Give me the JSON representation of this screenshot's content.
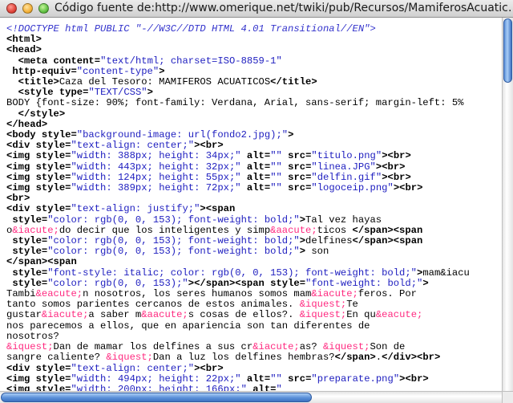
{
  "window": {
    "title": "Código fuente de:http://www.omerique.net/twiki/pub/Recursos/MamiferosAcuatic…"
  },
  "source_lines": [
    [
      {
        "t": "<!DOCTYPE html PUBLIC \"-//W3C//DTD HTML 4.01 Transitional//EN\">",
        "c": "doctype"
      }
    ],
    [
      {
        "t": "<html>",
        "c": "tag"
      }
    ],
    [
      {
        "t": "<head>",
        "c": "tag"
      }
    ],
    [
      {
        "t": "  "
      },
      {
        "t": "<meta",
        "c": "tag"
      },
      {
        "t": " content",
        "c": "attr"
      },
      {
        "t": "=",
        "c": "attr"
      },
      {
        "t": "\"text/html; charset=ISO-8859-1\"",
        "c": "val"
      }
    ],
    [
      {
        "t": " http-equiv",
        "c": "attr"
      },
      {
        "t": "=",
        "c": "attr"
      },
      {
        "t": "\"content-type\"",
        "c": "val"
      },
      {
        "t": ">",
        "c": "tag"
      }
    ],
    [
      {
        "t": "  "
      },
      {
        "t": "<title>",
        "c": "tag"
      },
      {
        "t": "Caza del Tesoro: MAMIFEROS ACUATICOS"
      },
      {
        "t": "</title>",
        "c": "tag"
      }
    ],
    [
      {
        "t": "  "
      },
      {
        "t": "<style",
        "c": "tag"
      },
      {
        "t": " type",
        "c": "attr"
      },
      {
        "t": "=",
        "c": "attr"
      },
      {
        "t": "\"TEXT/CSS\"",
        "c": "val"
      },
      {
        "t": ">",
        "c": "tag"
      }
    ],
    [
      {
        "t": "BODY {font-size: 90%; font-family: Verdana, Arial, sans-serif; margin-left: 5%"
      }
    ],
    [
      {
        "t": "  "
      },
      {
        "t": "</style>",
        "c": "tag"
      }
    ],
    [
      {
        "t": "</head>",
        "c": "tag"
      }
    ],
    [
      {
        "t": "<body",
        "c": "tag"
      },
      {
        "t": " style",
        "c": "attr"
      },
      {
        "t": "=",
        "c": "attr"
      },
      {
        "t": "\"background-image: url(fondo2.jpg);\"",
        "c": "val"
      },
      {
        "t": ">",
        "c": "tag"
      }
    ],
    [
      {
        "t": "<div",
        "c": "tag"
      },
      {
        "t": " style",
        "c": "attr"
      },
      {
        "t": "=",
        "c": "attr"
      },
      {
        "t": "\"text-align: center;\"",
        "c": "val"
      },
      {
        "t": "><br>",
        "c": "tag"
      }
    ],
    [
      {
        "t": "<img",
        "c": "tag"
      },
      {
        "t": " style",
        "c": "attr"
      },
      {
        "t": "=",
        "c": "attr"
      },
      {
        "t": "\"width: 388px; height: 34px;\"",
        "c": "val"
      },
      {
        "t": " alt",
        "c": "attr"
      },
      {
        "t": "=",
        "c": "attr"
      },
      {
        "t": "\"\"",
        "c": "val"
      },
      {
        "t": " src",
        "c": "attr"
      },
      {
        "t": "=",
        "c": "attr"
      },
      {
        "t": "\"titulo.png\"",
        "c": "val"
      },
      {
        "t": "><br>",
        "c": "tag"
      }
    ],
    [
      {
        "t": "<img",
        "c": "tag"
      },
      {
        "t": " style",
        "c": "attr"
      },
      {
        "t": "=",
        "c": "attr"
      },
      {
        "t": "\"width: 443px; height: 32px;\"",
        "c": "val"
      },
      {
        "t": " alt",
        "c": "attr"
      },
      {
        "t": "=",
        "c": "attr"
      },
      {
        "t": "\"\"",
        "c": "val"
      },
      {
        "t": " src",
        "c": "attr"
      },
      {
        "t": "=",
        "c": "attr"
      },
      {
        "t": "\"linea.JPG\"",
        "c": "val"
      },
      {
        "t": "><br>",
        "c": "tag"
      }
    ],
    [
      {
        "t": "<img",
        "c": "tag"
      },
      {
        "t": " style",
        "c": "attr"
      },
      {
        "t": "=",
        "c": "attr"
      },
      {
        "t": "\"width: 124px; height: 55px;\"",
        "c": "val"
      },
      {
        "t": " alt",
        "c": "attr"
      },
      {
        "t": "=",
        "c": "attr"
      },
      {
        "t": "\"\"",
        "c": "val"
      },
      {
        "t": " src",
        "c": "attr"
      },
      {
        "t": "=",
        "c": "attr"
      },
      {
        "t": "\"delfin.gif\"",
        "c": "val"
      },
      {
        "t": "><br>",
        "c": "tag"
      }
    ],
    [
      {
        "t": "<img",
        "c": "tag"
      },
      {
        "t": " style",
        "c": "attr"
      },
      {
        "t": "=",
        "c": "attr"
      },
      {
        "t": "\"width: 389px; height: 72px;\"",
        "c": "val"
      },
      {
        "t": " alt",
        "c": "attr"
      },
      {
        "t": "=",
        "c": "attr"
      },
      {
        "t": "\"\"",
        "c": "val"
      },
      {
        "t": " src",
        "c": "attr"
      },
      {
        "t": "=",
        "c": "attr"
      },
      {
        "t": "\"logoceip.png\"",
        "c": "val"
      },
      {
        "t": "><br>",
        "c": "tag"
      }
    ],
    [
      {
        "t": "<br>",
        "c": "tag"
      }
    ],
    [
      {
        "t": "<div",
        "c": "tag"
      },
      {
        "t": " style",
        "c": "attr"
      },
      {
        "t": "=",
        "c": "attr"
      },
      {
        "t": "\"text-align: justify;\"",
        "c": "val"
      },
      {
        "t": "><span",
        "c": "tag"
      }
    ],
    [
      {
        "t": " style",
        "c": "attr"
      },
      {
        "t": "=",
        "c": "attr"
      },
      {
        "t": "\"color: rgb(0, 0, 153); font-weight: bold;\"",
        "c": "val"
      },
      {
        "t": ">",
        "c": "tag"
      },
      {
        "t": "Tal vez hayas"
      }
    ],
    [
      {
        "t": "o"
      },
      {
        "t": "&iacute;",
        "c": "ent"
      },
      {
        "t": "do decir que los inteligentes y simp"
      },
      {
        "t": "&aacute;",
        "c": "ent"
      },
      {
        "t": "ticos "
      },
      {
        "t": "</span><span",
        "c": "tag"
      }
    ],
    [
      {
        "t": " style",
        "c": "attr"
      },
      {
        "t": "=",
        "c": "attr"
      },
      {
        "t": "\"color: rgb(0, 0, 153); font-weight: bold;\"",
        "c": "val"
      },
      {
        "t": ">",
        "c": "tag"
      },
      {
        "t": "delfines"
      },
      {
        "t": "</span><span",
        "c": "tag"
      }
    ],
    [
      {
        "t": " style",
        "c": "attr"
      },
      {
        "t": "=",
        "c": "attr"
      },
      {
        "t": "\"color: rgb(0, 0, 153); font-weight: bold;\"",
        "c": "val"
      },
      {
        "t": ">",
        "c": "tag"
      },
      {
        "t": " son"
      }
    ],
    [
      {
        "t": "</span><span",
        "c": "tag"
      }
    ],
    [
      {
        "t": " style",
        "c": "attr"
      },
      {
        "t": "=",
        "c": "attr"
      },
      {
        "t": "\"font-style: italic; color: rgb(0, 0, 153); font-weight: bold;\"",
        "c": "val"
      },
      {
        "t": ">",
        "c": "tag"
      },
      {
        "t": "mam&iacu"
      }
    ],
    [
      {
        "t": " style",
        "c": "attr"
      },
      {
        "t": "=",
        "c": "attr"
      },
      {
        "t": "\"color: rgb(0, 0, 153);\"",
        "c": "val"
      },
      {
        "t": "></span><span",
        "c": "tag"
      },
      {
        "t": " style",
        "c": "attr"
      },
      {
        "t": "=",
        "c": "attr"
      },
      {
        "t": "\"font-weight: bold;\"",
        "c": "val"
      },
      {
        "t": ">",
        "c": "tag"
      }
    ],
    [
      {
        "t": "Tambi"
      },
      {
        "t": "&eacute;",
        "c": "ent"
      },
      {
        "t": "n nosotros, los seres humanos somos mam"
      },
      {
        "t": "&iacute;",
        "c": "ent"
      },
      {
        "t": "feros. Por"
      }
    ],
    [
      {
        "t": "tanto somos parientes cercanos de estos animales. "
      },
      {
        "t": "&iquest;",
        "c": "ent"
      },
      {
        "t": "Te"
      }
    ],
    [
      {
        "t": "gustar"
      },
      {
        "t": "&iacute;",
        "c": "ent"
      },
      {
        "t": "a saber m"
      },
      {
        "t": "&aacute;",
        "c": "ent"
      },
      {
        "t": "s cosas de ellos?. "
      },
      {
        "t": "&iquest;",
        "c": "ent"
      },
      {
        "t": "En qu"
      },
      {
        "t": "&eacute;",
        "c": "ent"
      }
    ],
    [
      {
        "t": "nos parecemos a ellos, que en apariencia son tan diferentes de"
      }
    ],
    [
      {
        "t": "nosotros?"
      }
    ],
    [
      {
        "t": "&iquest;",
        "c": "ent"
      },
      {
        "t": "Dan de mamar los delfines a sus cr"
      },
      {
        "t": "&iacute;",
        "c": "ent"
      },
      {
        "t": "as? "
      },
      {
        "t": "&iquest;",
        "c": "ent"
      },
      {
        "t": "Son de"
      }
    ],
    [
      {
        "t": "sangre caliente? "
      },
      {
        "t": "&iquest;",
        "c": "ent"
      },
      {
        "t": "Dan a luz los delfines hembras?"
      },
      {
        "t": "</span>",
        "c": "tag"
      },
      {
        "t": "."
      },
      {
        "t": "</div><br>",
        "c": "tag"
      }
    ],
    [
      {
        "t": "<div",
        "c": "tag"
      },
      {
        "t": " style",
        "c": "attr"
      },
      {
        "t": "=",
        "c": "attr"
      },
      {
        "t": "\"text-align: center;\"",
        "c": "val"
      },
      {
        "t": "><br>",
        "c": "tag"
      }
    ],
    [
      {
        "t": "<img",
        "c": "tag"
      },
      {
        "t": " style",
        "c": "attr"
      },
      {
        "t": "=",
        "c": "attr"
      },
      {
        "t": "\"width: 494px; height: 22px;\"",
        "c": "val"
      },
      {
        "t": " alt",
        "c": "attr"
      },
      {
        "t": "=",
        "c": "attr"
      },
      {
        "t": "\"\"",
        "c": "val"
      },
      {
        "t": " src",
        "c": "attr"
      },
      {
        "t": "=",
        "c": "attr"
      },
      {
        "t": "\"preparate.png\"",
        "c": "val"
      },
      {
        "t": "><br>",
        "c": "tag"
      }
    ],
    [
      {
        "t": "<img",
        "c": "tag"
      },
      {
        "t": " style",
        "c": "attr"
      },
      {
        "t": "=",
        "c": "attr"
      },
      {
        "t": "\"width: 200px; height: 166px;\"",
        "c": "val"
      },
      {
        "t": " alt",
        "c": "attr"
      },
      {
        "t": "=",
        "c": "attr"
      },
      {
        "t": "\"",
        "c": "val"
      }
    ]
  ]
}
